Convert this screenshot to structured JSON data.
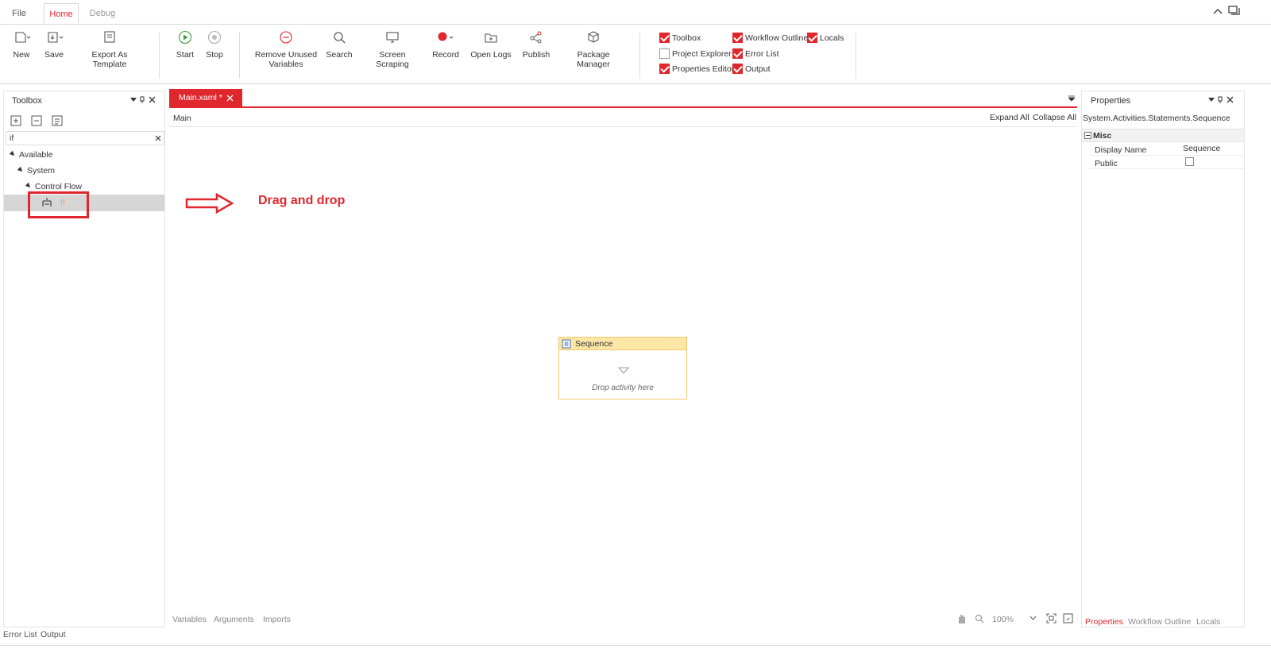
{
  "tabs": {
    "file": "File",
    "home": "Home",
    "debug": "Debug"
  },
  "ribbon": {
    "new": "New",
    "save": "Save",
    "export_template": "Export As Template",
    "start": "Start",
    "stop": "Stop",
    "remove_unused_line1": "Remove Unused",
    "remove_unused_line2": "Variables",
    "search": "Search",
    "screen_scraping": "Screen Scraping",
    "record": "Record",
    "open_logs": "Open Logs",
    "publish": "Publish",
    "package_manager": "Package Manager"
  },
  "panels_toggle": {
    "toolbox": "Toolbox",
    "workflow_outline": "Workflow Outline",
    "locals": "Locals",
    "project_explorer": "Project Explorer",
    "error_list": "Error List",
    "properties_editor": "Properties Editor",
    "output": "Output"
  },
  "toolbox": {
    "title": "Toolbox",
    "search_value": "if",
    "tree": {
      "available": "Available",
      "system": "System",
      "control_flow": "Control Flow",
      "if_item": "If"
    }
  },
  "designer": {
    "tab_label": "Main.xaml *",
    "breadcrumb": "Main",
    "expand_all": "Expand All",
    "collapse_all": "Collapse All",
    "annotation": "Drag and drop",
    "sequence_title": "Sequence",
    "drop_hint": "Drop activity here",
    "bottom_tabs": {
      "variables": "Variables",
      "arguments": "Arguments",
      "imports": "Imports"
    },
    "zoom": "100%"
  },
  "properties": {
    "title": "Properties",
    "type_name": "System.Activities.Statements.Sequence",
    "category": "Misc",
    "rows": [
      {
        "name": "Display Name",
        "value": "Sequence"
      },
      {
        "name": "Public",
        "value": ""
      }
    ],
    "bottom_tabs": {
      "properties": "Properties",
      "workflow_outline": "Workflow Outline",
      "locals": "Locals"
    }
  },
  "footer": {
    "error_list": "Error List",
    "output": "Output"
  },
  "colors": {
    "accent": "#e0272d",
    "sequence_header": "#fce7a7",
    "sequence_border": "#f3c86a"
  }
}
